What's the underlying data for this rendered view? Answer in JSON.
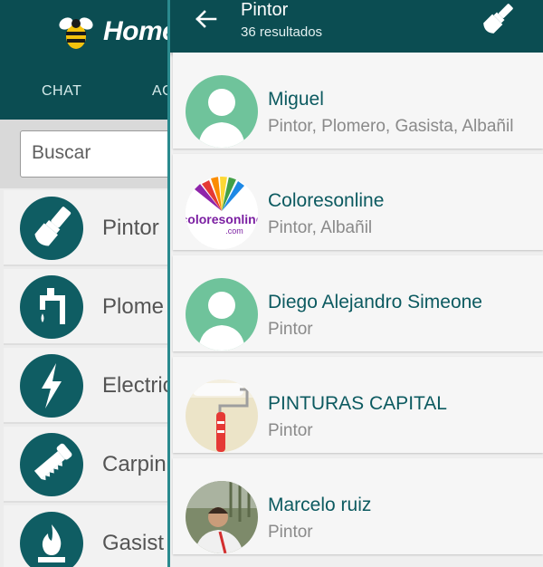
{
  "background_screen": {
    "app_title": "Home",
    "tabs": [
      {
        "label": "CHAT"
      },
      {
        "label": "AG"
      }
    ],
    "search": {
      "placeholder": "Buscar",
      "value": ""
    },
    "categories": [
      {
        "label": "Pintor",
        "icon": "paintbrush-icon"
      },
      {
        "label": "Plome",
        "icon": "faucet-icon"
      },
      {
        "label": "Electric",
        "icon": "lightning-icon"
      },
      {
        "label": "Carpin",
        "icon": "saw-icon"
      },
      {
        "label": "Gasist",
        "icon": "flame-icon"
      }
    ]
  },
  "results_screen": {
    "title": "Pintor",
    "subtitle": "36 resultados",
    "header_icon": "paintbrush-icon",
    "results": [
      {
        "name": "Miguel",
        "trades": "Pintor, Plomero, Gasista, Albañil",
        "avatar": "default-avatar"
      },
      {
        "name": "Coloresonline",
        "trades": "Pintor, Albañil",
        "avatar": "coloresonline-logo",
        "logo_text": "coloresonline",
        "logo_domain": ".com"
      },
      {
        "name": "Diego Alejandro Simeone",
        "trades": "Pintor",
        "avatar": "default-avatar"
      },
      {
        "name": "PINTURAS CAPITAL",
        "trades": "Pintor",
        "avatar": "paint-roller-photo"
      },
      {
        "name": "Marcelo ruiz",
        "trades": "Pintor",
        "avatar": "person-photo"
      }
    ]
  },
  "colors": {
    "primary": "#0b4d52",
    "icon_circle": "#0f5d63",
    "avatar_green": "#6fc39b",
    "name_text": "#0c5a60",
    "sub_text": "#8a8a8a",
    "drawer_edge": "#2a8a8e"
  }
}
